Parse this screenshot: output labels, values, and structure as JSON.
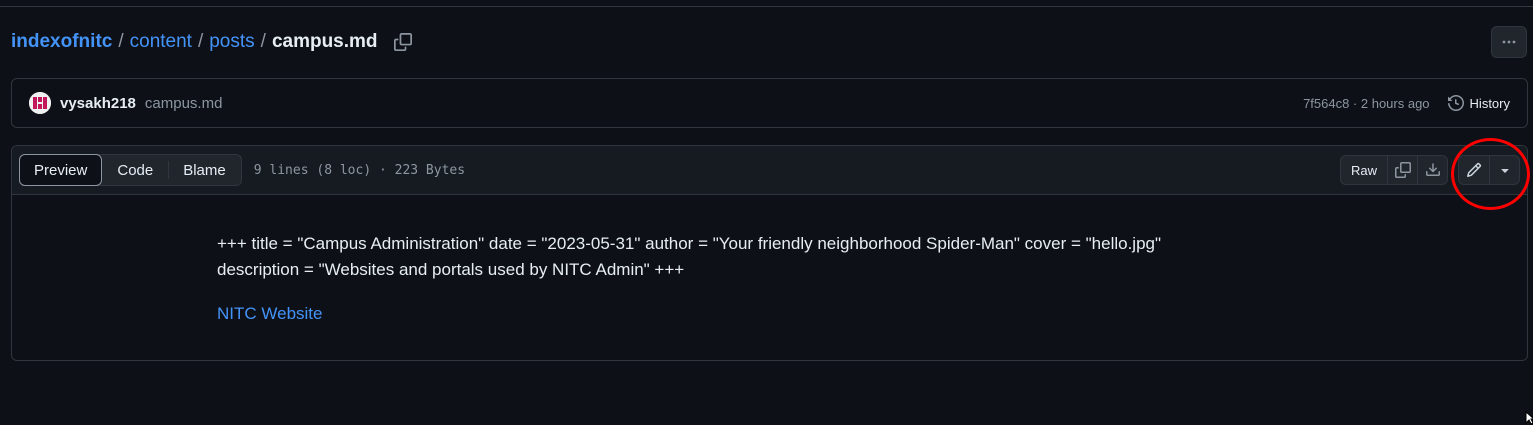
{
  "breadcrumb": {
    "repo": "indexofnitc",
    "sep": "/",
    "dir1": "content",
    "dir2": "posts",
    "file": "campus.md"
  },
  "commit": {
    "author": "vysakh218",
    "message": "campus.md",
    "hash_time": "7f564c8 · 2 hours ago",
    "history_label": "History"
  },
  "file_header": {
    "tabs": [
      "Preview",
      "Code",
      "Blame"
    ],
    "active_tab": "Preview",
    "info": "9 lines (8 loc) · 223 Bytes",
    "raw_label": "Raw"
  },
  "content": {
    "line1": "+++ title = \"Campus Administration\" date = \"2023-05-31\" author = \"Your friendly neighborhood Spider-Man\" cover = \"hello.jpg\"",
    "line2": "description = \"Websites and portals used by NITC Admin\" +++",
    "link": "NITC Website"
  },
  "icons": {
    "copy_path": "copy-icon",
    "more": "kebab-horizontal-icon",
    "history": "history-icon",
    "copy_raw": "copy-icon",
    "download": "download-icon",
    "edit": "pencil-icon",
    "edit_more": "triangle-down-icon"
  },
  "colors": {
    "bg": "#0d1117",
    "link": "#4493f8",
    "annotation": "#ff0000"
  }
}
